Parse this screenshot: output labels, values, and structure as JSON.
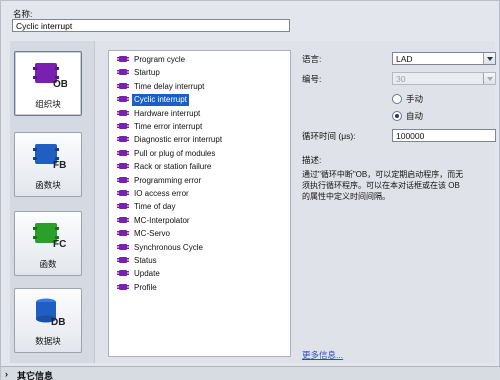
{
  "name_section": {
    "label": "名称:",
    "value": "Cyclic interrupt"
  },
  "block_types": [
    {
      "icon": "ob-block-icon",
      "icon_text": "OB",
      "label": "组织块",
      "color": "#7a20b0"
    },
    {
      "icon": "fb-block-icon",
      "icon_text": "FB",
      "label": "函数块",
      "color": "#1f5fc4"
    },
    {
      "icon": "fc-block-icon",
      "icon_text": "FC",
      "label": "函数",
      "color": "#2aa02a"
    },
    {
      "icon": "db-block-icon",
      "icon_text": "DB",
      "label": "数据块",
      "color": "#1f5fc4"
    }
  ],
  "ob_list": [
    "Program cycle",
    "Startup",
    "Time delay interrupt",
    "Cyclic interrupt",
    "Hardware interrupt",
    "Time error interrupt",
    "Diagnostic error interrupt",
    "Pull or plug of modules",
    "Rack or station failure",
    "Programming error",
    "IO access error",
    "Time of day",
    "MC-Interpolator",
    "MC-Servo",
    "Synchronous Cycle",
    "Status",
    "Update",
    "Profile"
  ],
  "ob_list_selected": "Cyclic interrupt",
  "properties": {
    "language_label": "语言:",
    "language_value": "LAD",
    "number_label": "编号:",
    "number_value": "30",
    "manual_label": "手动",
    "auto_label": "自动",
    "number_mode": "auto",
    "cycle_time_label": "循环时间 (μs):",
    "cycle_time_value": "100000",
    "description_label": "描述:",
    "description_lines": [
      "通过\"循环中断\"OB，可以定期启动程序，而无",
      "须执行循环程序。可以在本对话框或在该 OB",
      "的属性中定义时间间隔。"
    ],
    "more_info": "更多信息..."
  },
  "footer": {
    "label": "其它信息"
  },
  "colors": {
    "selection": "#1860c8",
    "ob_icon": "#7a20b0",
    "link": "#2a4fb8"
  }
}
